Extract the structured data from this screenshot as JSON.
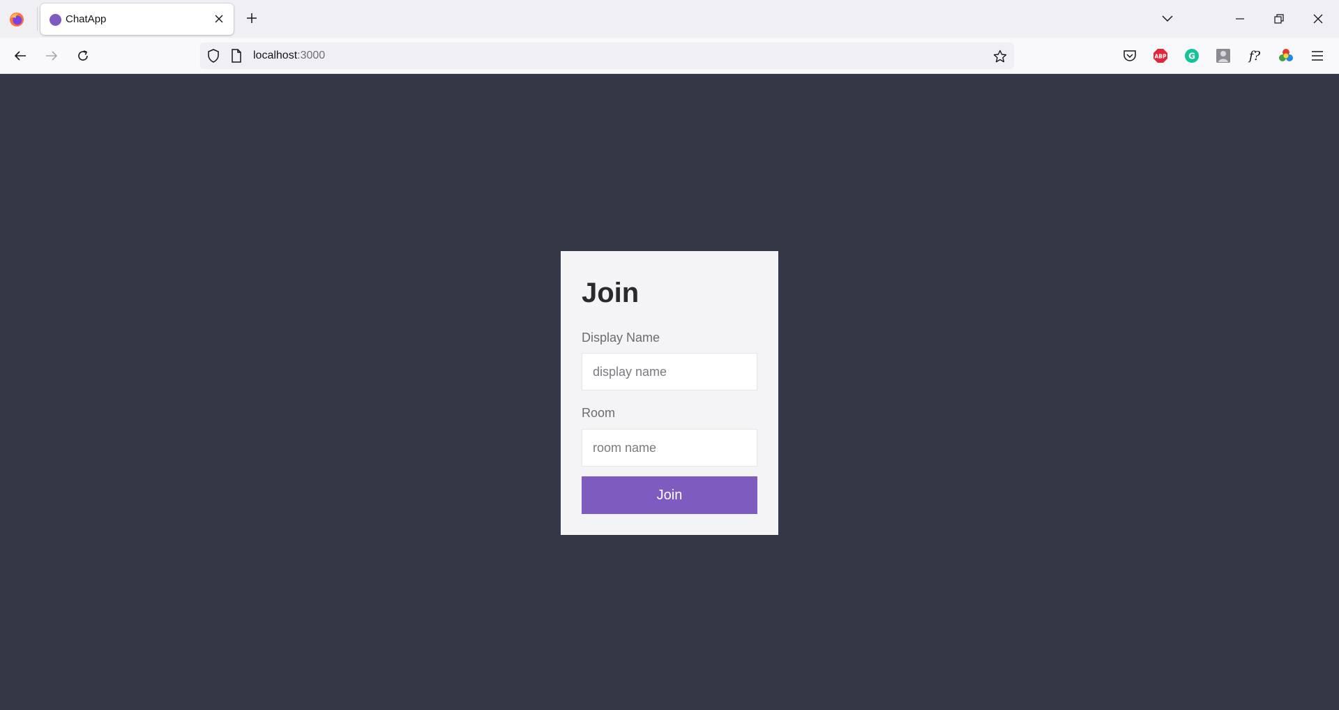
{
  "browser": {
    "tab": {
      "title": "ChatApp",
      "favicon_color": "#7e5bbe"
    },
    "url": {
      "host": "localhost",
      "port": ":3000"
    },
    "icons": {
      "firefox": "firefox-logo-icon",
      "close_tab": "close-icon",
      "new_tab": "plus-icon",
      "tab_list": "chevron-down-icon",
      "minimize": "minimize-icon",
      "restore": "restore-icon",
      "close_window": "close-icon",
      "back": "arrow-left-icon",
      "forward": "arrow-right-icon",
      "reload": "reload-icon",
      "shield": "shield-icon",
      "page": "page-icon",
      "bookmark": "star-icon",
      "pocket": "pocket-icon",
      "adblock": "adblock-icon",
      "grammarly": "grammarly-icon",
      "profile_ext": "extension-avatar-icon",
      "font_finder": "font-finder-icon",
      "color_ext": "color-picker-icon",
      "menu": "hamburger-menu-icon"
    },
    "extensions": {
      "adblock_label": "ABP",
      "grammarly_label": "G",
      "fontfinder_label": "f?"
    }
  },
  "join_form": {
    "title": "Join",
    "display_name_label": "Display Name",
    "display_name_placeholder": "display name",
    "display_name_value": "",
    "room_label": "Room",
    "room_placeholder": "room name",
    "room_value": "",
    "submit_label": "Join"
  },
  "colors": {
    "page_background": "#343846",
    "card_background": "#f4f4f6",
    "accent": "#7e5bbe",
    "adblock_red": "#e0263a",
    "grammarly_green": "#15c39a"
  }
}
